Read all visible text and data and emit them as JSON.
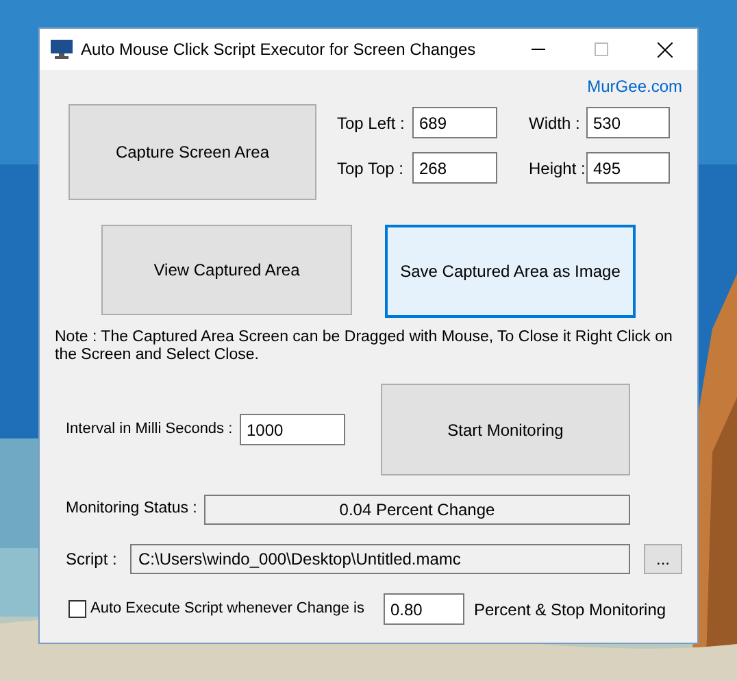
{
  "window": {
    "title": "Auto Mouse Click Script Executor for Screen Changes"
  },
  "link": "MurGee.com",
  "capture_button": "Capture Screen Area",
  "fields": [
    {
      "label": "Top Left :",
      "value": "689"
    },
    {
      "label": "Width :",
      "value": "530"
    },
    {
      "label": "Top Top :",
      "value": "268"
    },
    {
      "label": "Height :",
      "value": "495"
    }
  ],
  "buttons": [
    {
      "label": "View Captured Area",
      "focused": false
    },
    {
      "label": "Save Captured Area as Image",
      "focused": true
    }
  ],
  "note": "Note : The Captured Area Screen can be Dragged with Mouse, To Close it Right Click on the Screen and Select Close.",
  "interval": {
    "label": "Interval in Milli Seconds :",
    "value": "1000"
  },
  "start_button": "Start Monitoring",
  "status": {
    "label": "Monitoring Status :",
    "value": "0.04 Percent Change"
  },
  "script": {
    "label": "Script :",
    "value": "C:\\Users\\windo_000\\Desktop\\Untitled.mamc",
    "browse": "..."
  },
  "auto_execute": {
    "label": "Auto Execute Script whenever Change is",
    "checked": false,
    "value": "0.80",
    "suffix": "Percent & Stop Monitoring"
  }
}
